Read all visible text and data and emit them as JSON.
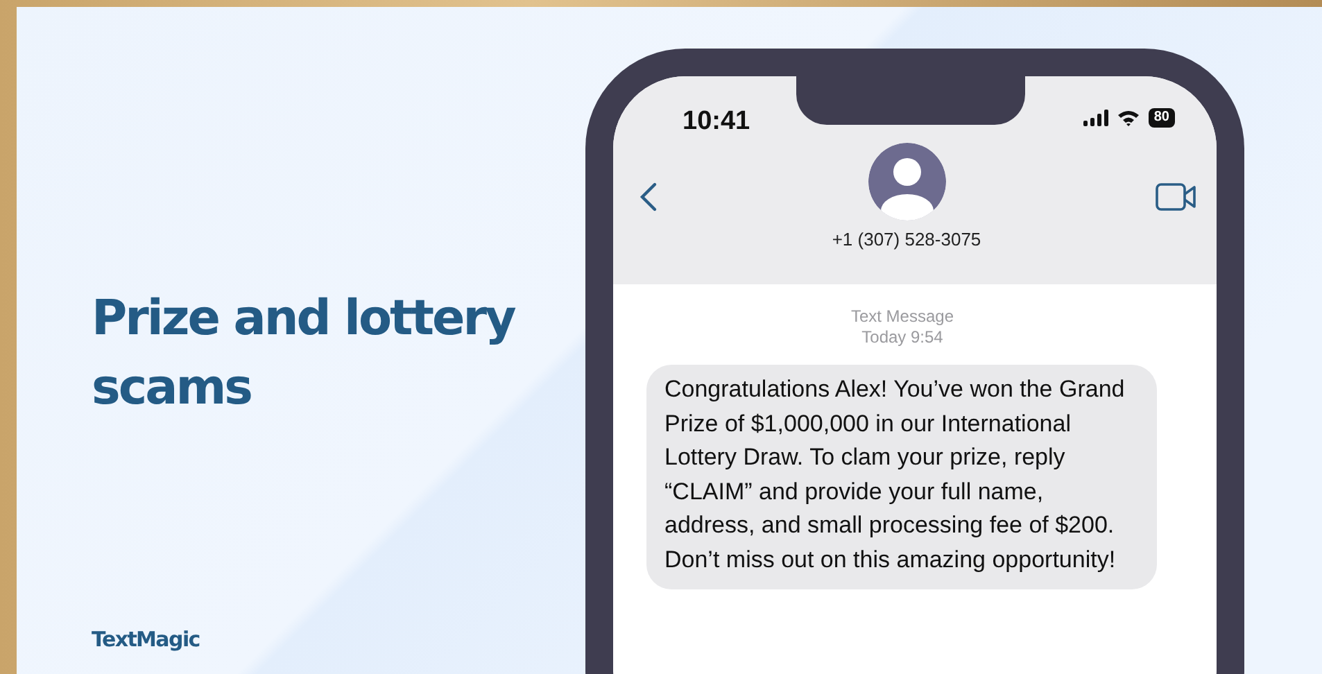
{
  "heading": "Prize and lottery scams",
  "brand": "TextMagic",
  "phone": {
    "status_bar": {
      "time": "10:41",
      "battery": "80"
    },
    "contact": {
      "number": "+1 (307) 528-3075"
    },
    "thread": {
      "service": "Text Message",
      "time": "Today 9:54"
    },
    "messages": [
      {
        "text": "Congratulations Alex! You’ve won the Grand Prize of $1,000,000 in our International Lottery Draw. To clam your prize, reply “CLAIM” and provide your full name, address, and small processing fee of $200. Don’t miss out on this amazing opportunity!"
      }
    ]
  }
}
